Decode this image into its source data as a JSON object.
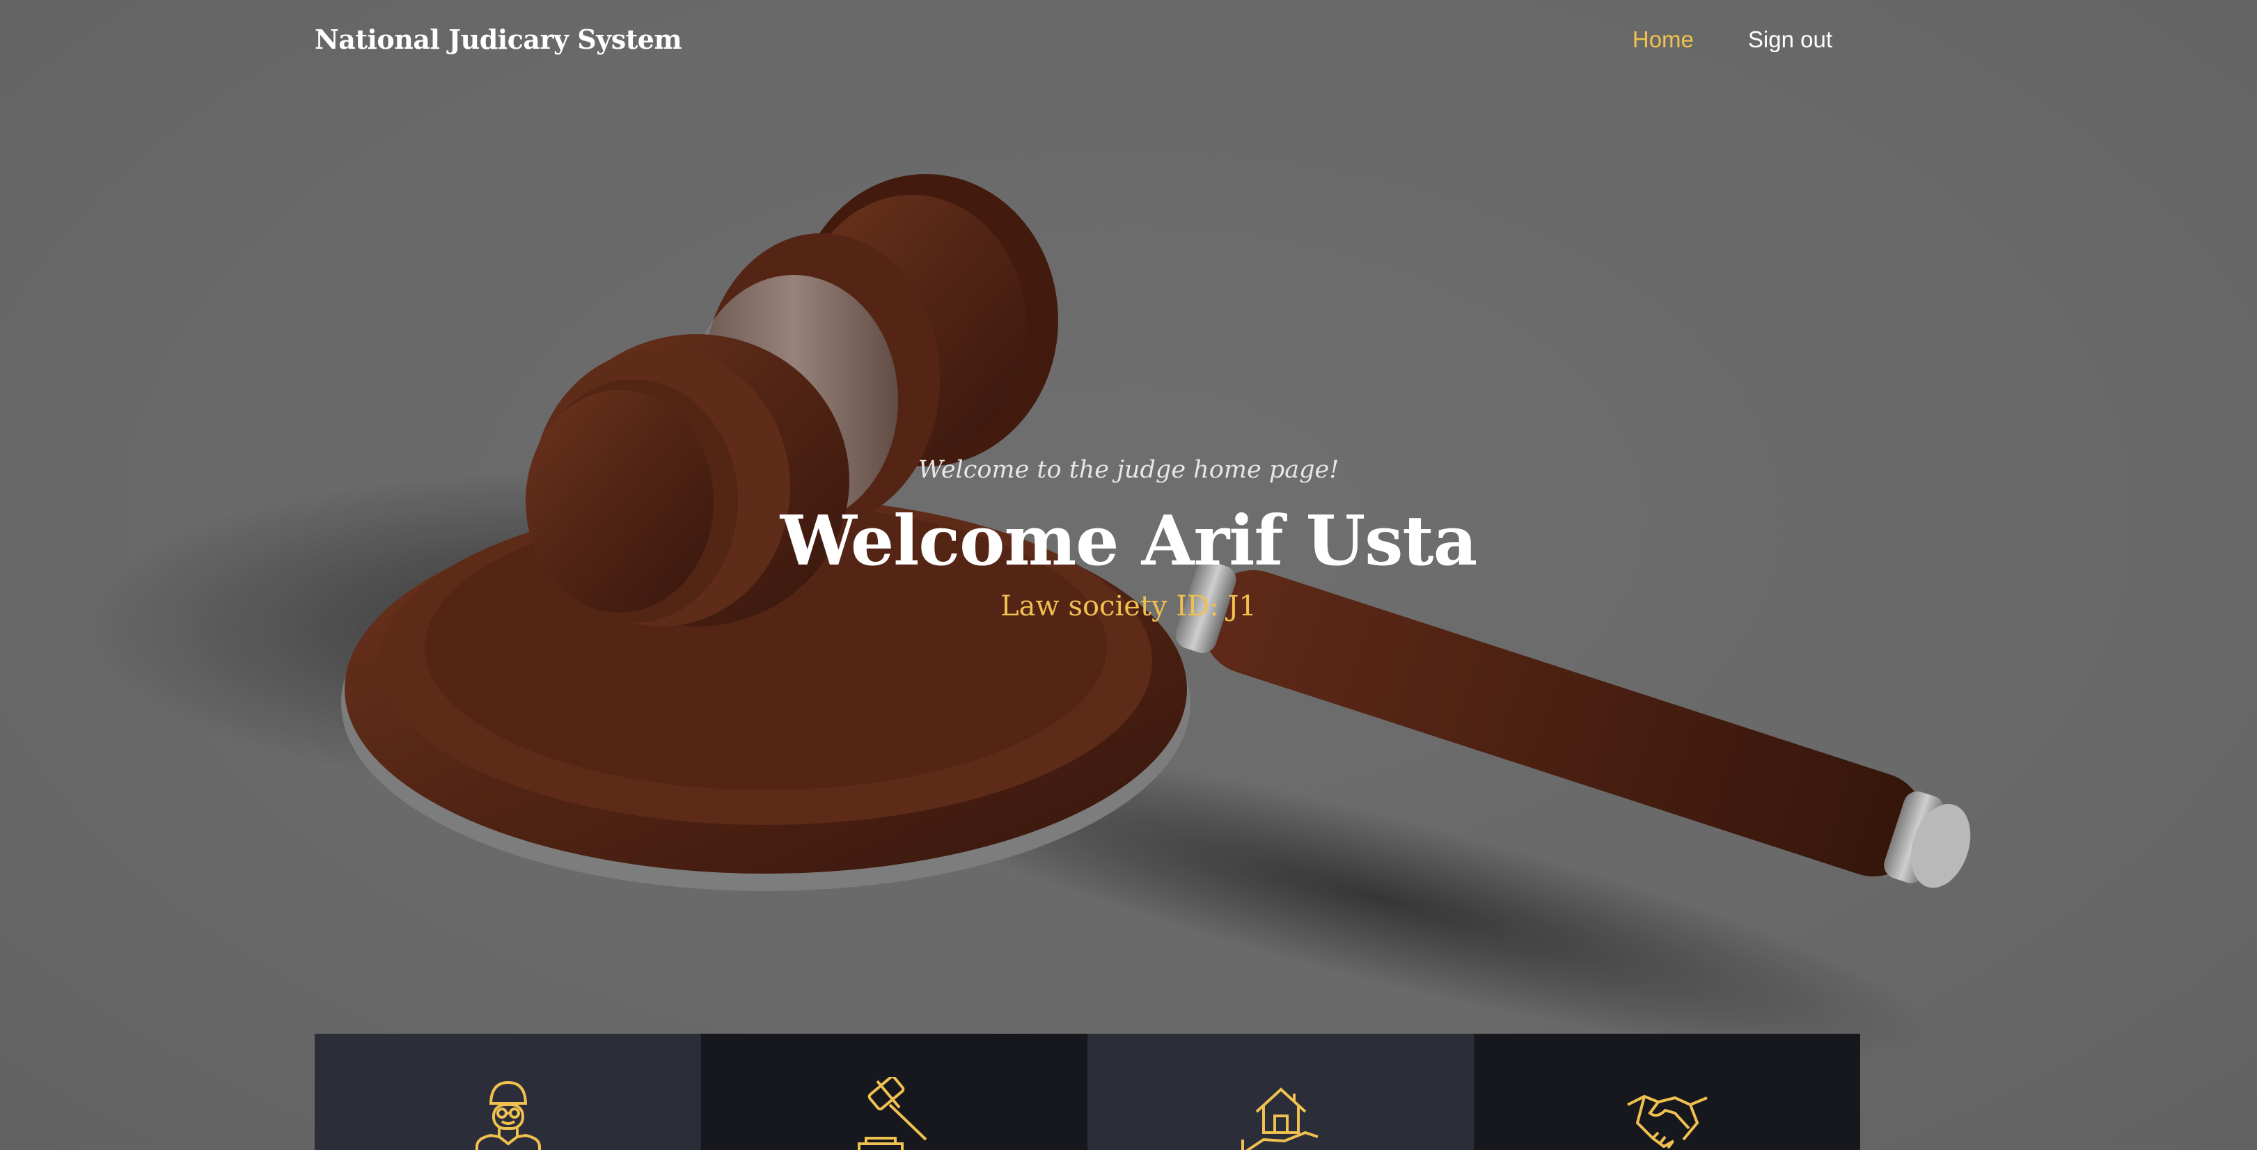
{
  "header": {
    "brand": "National Judicary System",
    "nav": [
      {
        "label": "Home",
        "active": true
      },
      {
        "label": "Sign out",
        "active": false
      }
    ]
  },
  "hero": {
    "tagline": "Welcome to the judge home page!",
    "title": "Welcome Arif Usta",
    "subtitle": "Law society ID: J1"
  },
  "tiles": [
    {
      "icon": "lawyer-icon"
    },
    {
      "icon": "gavel-icon"
    },
    {
      "icon": "house-in-hand-icon"
    },
    {
      "icon": "handshake-icon"
    }
  ],
  "colors": {
    "accent": "#f0c050",
    "tile_light": "#2b2d39",
    "tile_dark": "#17181d"
  }
}
